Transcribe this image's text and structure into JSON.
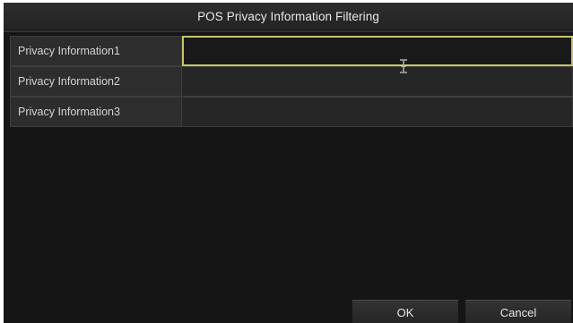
{
  "dialog": {
    "title": "POS Privacy Information Filtering"
  },
  "privacy_rows": [
    {
      "label": "Privacy Information1",
      "value": ""
    },
    {
      "label": "Privacy Information2",
      "value": ""
    },
    {
      "label": "Privacy Information3",
      "value": ""
    }
  ],
  "buttons": {
    "ok_label": "OK",
    "cancel_label": "Cancel"
  },
  "icons": {
    "text_cursor": "i-beam-cursor-icon"
  },
  "colors": {
    "background": "#151515",
    "title_bar": "#262626",
    "active_field_border": "#c5c56a",
    "label_cell": "#2d2d2d",
    "text": "#e6e6e6"
  }
}
